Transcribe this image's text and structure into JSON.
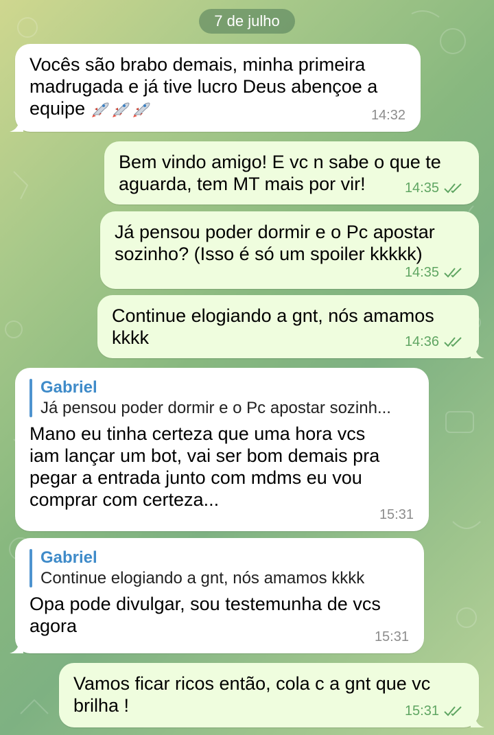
{
  "chat": {
    "date_separator": "7 de julho",
    "messages": [
      {
        "direction": "incoming",
        "text": "Vocês são brabo demais, minha primeira\nmadrugada e já tive lucro Deus abençoe a\nequipe",
        "emoji": [
          "rocket",
          "rocket",
          "rocket"
        ],
        "time": "14:32"
      },
      {
        "direction": "outgoing",
        "text": "Bem vindo amigo! E vc n sabe o que te\naguarda, tem MT mais por vir!",
        "time": "14:35",
        "status": "read"
      },
      {
        "direction": "outgoing",
        "text": "Já pensou poder dormir e o Pc apostar\nsozinho? (Isso é só um spoiler kkkkk)",
        "time": "14:35",
        "status": "read"
      },
      {
        "direction": "outgoing",
        "text": "Continue elogiando a gnt, nós amamos\nkkkk",
        "time": "14:36",
        "status": "read"
      },
      {
        "direction": "incoming",
        "reply_to": {
          "name": "Gabriel",
          "text": "Já pensou poder dormir e o Pc apostar sozinh..."
        },
        "text": "Mano eu tinha certeza que uma hora vcs\niam lançar um bot, vai ser bom demais pra\npegar a entrada junto com mdms eu vou\ncomprar com certeza...",
        "time": "15:31"
      },
      {
        "direction": "incoming",
        "reply_to": {
          "name": "Gabriel",
          "text": "Continue elogiando a gnt, nós amamos kkkk"
        },
        "text": "Opa pode divulgar, sou testemunha de vcs\nagora",
        "time": "15:31"
      },
      {
        "direction": "outgoing",
        "text": "Vamos ficar ricos então, cola c a gnt que vc\nbrilha !",
        "time": "15:31",
        "status": "read"
      }
    ],
    "colors": {
      "incoming_bubble": "#ffffff",
      "outgoing_bubble": "#effdde",
      "read_check": "#5fa562",
      "reply_accent": "#3f8bc9"
    }
  }
}
